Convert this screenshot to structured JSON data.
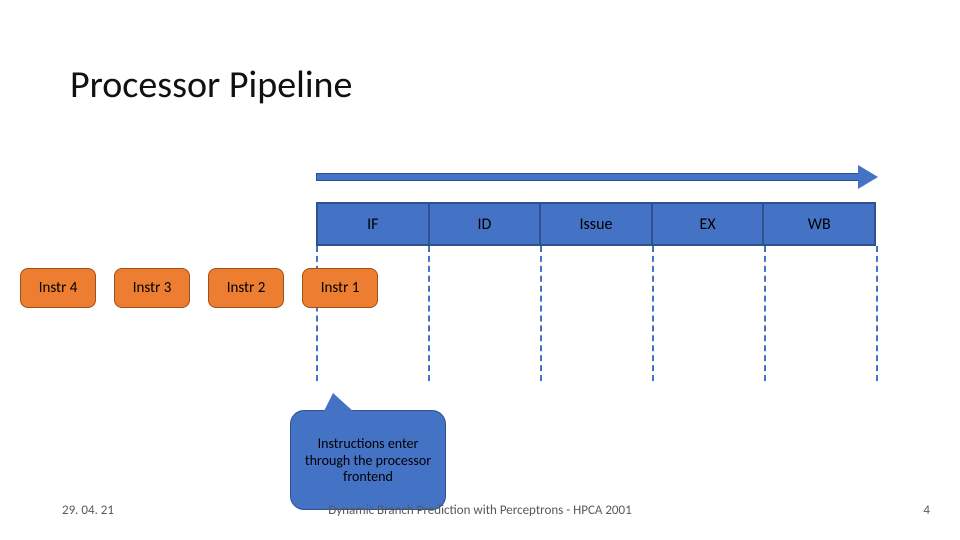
{
  "title": "Processor Pipeline",
  "stages": [
    "IF",
    "ID",
    "Issue",
    "EX",
    "WB"
  ],
  "instructions": [
    "Instr 4",
    "Instr 3",
    "Instr 2",
    "Instr 1"
  ],
  "callout_text": "Instructions enter through the processor frontend",
  "footer": {
    "date": "29. 04. 21",
    "caption": "Dynamic Branch Prediction with Perceptrons - HPCA 2001",
    "page": "4"
  },
  "colors": {
    "stage_fill": "#4472c4",
    "stage_border": "#2f528f",
    "instr_fill": "#ed7d31",
    "instr_border": "#a05019"
  }
}
